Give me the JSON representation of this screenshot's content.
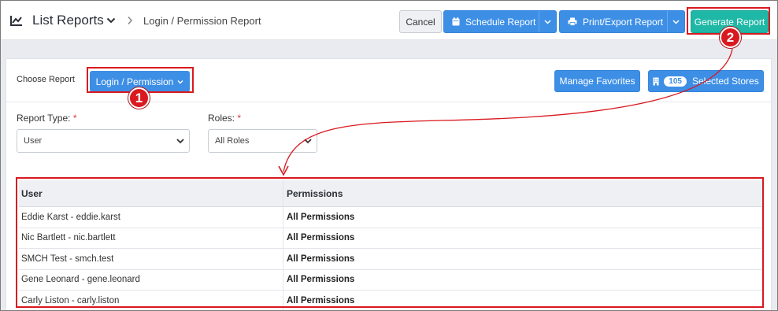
{
  "header": {
    "title": "List Reports",
    "breadcrumb": "Login / Permission Report",
    "cancel_label": "Cancel",
    "schedule_label": "Schedule Report",
    "print_label": "Print/Export Report",
    "generate_label": "Generate Report"
  },
  "report_selector": {
    "choose_label": "Choose Report",
    "selected_report": "Login / Permission",
    "manage_favorites_label": "Manage Favorites",
    "stores_count": "105",
    "stores_label": "Selected Stores"
  },
  "filters": {
    "report_type_label": "Report Type:",
    "report_type_value": "User",
    "roles_label": "Roles:",
    "roles_value": "All Roles",
    "required_mark": "*"
  },
  "table": {
    "columns": [
      "User",
      "Permissions"
    ],
    "rows": [
      {
        "user": "Eddie Karst - eddie.karst",
        "permissions": "All Permissions"
      },
      {
        "user": "Nic Bartlett - nic.bartlett",
        "permissions": "All Permissions"
      },
      {
        "user": "SMCH Test - smch.test",
        "permissions": "All Permissions"
      },
      {
        "user": "Gene Leonard - gene.leonard",
        "permissions": "All Permissions"
      },
      {
        "user": "Carly Liston - carly.liston",
        "permissions": "All Permissions"
      }
    ]
  },
  "annotations": {
    "step_1": "1",
    "step_2": "2",
    "highlight_color": "#d9191f"
  },
  "colors": {
    "primary_blue": "#3d8fe6",
    "generate_teal": "#1fb8a6"
  }
}
